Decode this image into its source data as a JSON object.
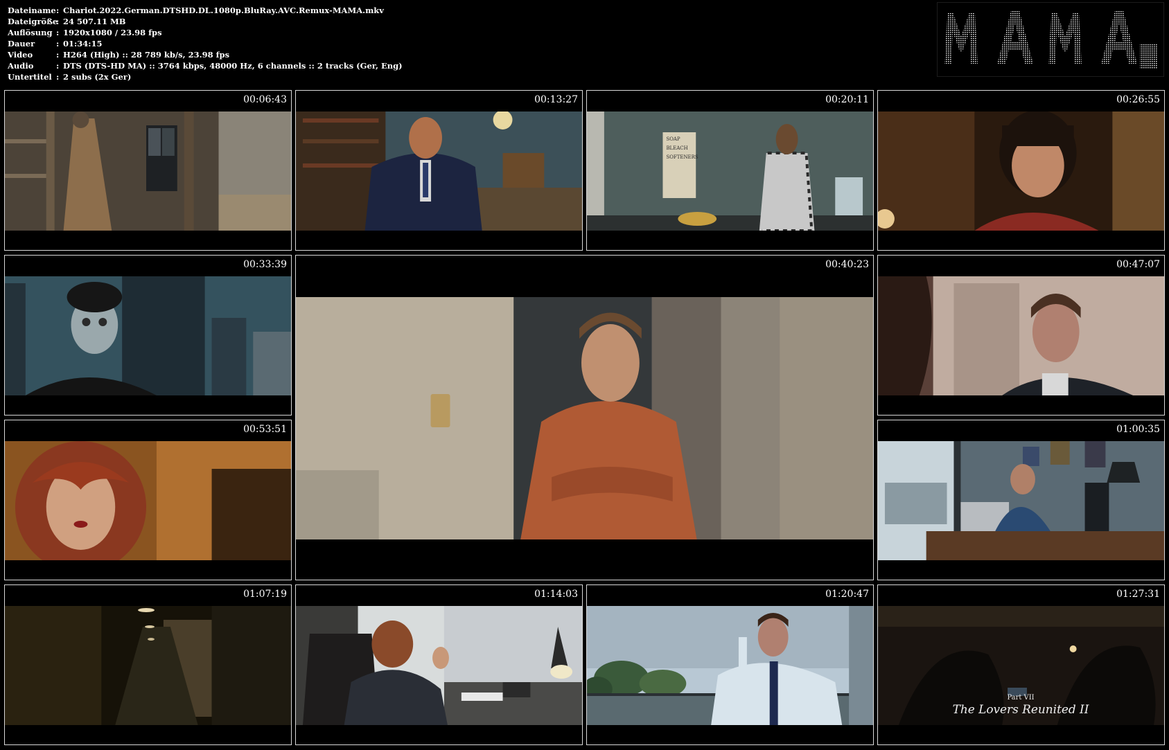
{
  "info": {
    "rows": [
      {
        "key": "Dateiname",
        "sep": ":",
        "value": "Chariot.2022.German.DTSHD.DL.1080p.BluRay.AVC.Remux-MAMA.mkv"
      },
      {
        "key": "Dateigröße",
        "sep": ":",
        "value": "24 507.11 MB"
      },
      {
        "key": "Auflösung",
        "sep": ":",
        "value": "1920x1080 / 23.98 fps"
      },
      {
        "key": "Dauer",
        "sep": ":",
        "value": "01:34:15"
      },
      {
        "key": "Video",
        "sep": ":",
        "value": "H264 (High) :: 28 789 kb/s, 23.98 fps"
      },
      {
        "key": "Audio",
        "sep": ":",
        "value": "DTS (DTS-HD MA) :: 3764 kbps, 48000 Hz, 6 channels :: 2 tracks (Ger, Eng)"
      },
      {
        "key": "Untertitel",
        "sep": ":",
        "value": "2 subs (2x Ger)"
      }
    ]
  },
  "logo": {
    "icon": "ascii-art-logo"
  },
  "thumbnails": [
    {
      "time": "00:06:43"
    },
    {
      "time": "00:13:27"
    },
    {
      "time": "00:20:11"
    },
    {
      "time": "00:26:55"
    },
    {
      "time": "00:33:39"
    },
    {
      "time": "00:40:23"
    },
    {
      "time": "00:47:07"
    },
    {
      "time": "00:53:51"
    },
    {
      "time": "01:00:35"
    },
    {
      "time": "01:07:19"
    },
    {
      "time": "01:14:03"
    },
    {
      "time": "01:20:47"
    },
    {
      "time": "01:27:31"
    }
  ],
  "frame_text": {
    "poster_line1": "SOAP",
    "poster_line2": "BLEACH",
    "poster_line3": "SOFTENERS",
    "subtitle_line1": "Part VII",
    "subtitle_line2": "The Lovers Reunited II"
  }
}
